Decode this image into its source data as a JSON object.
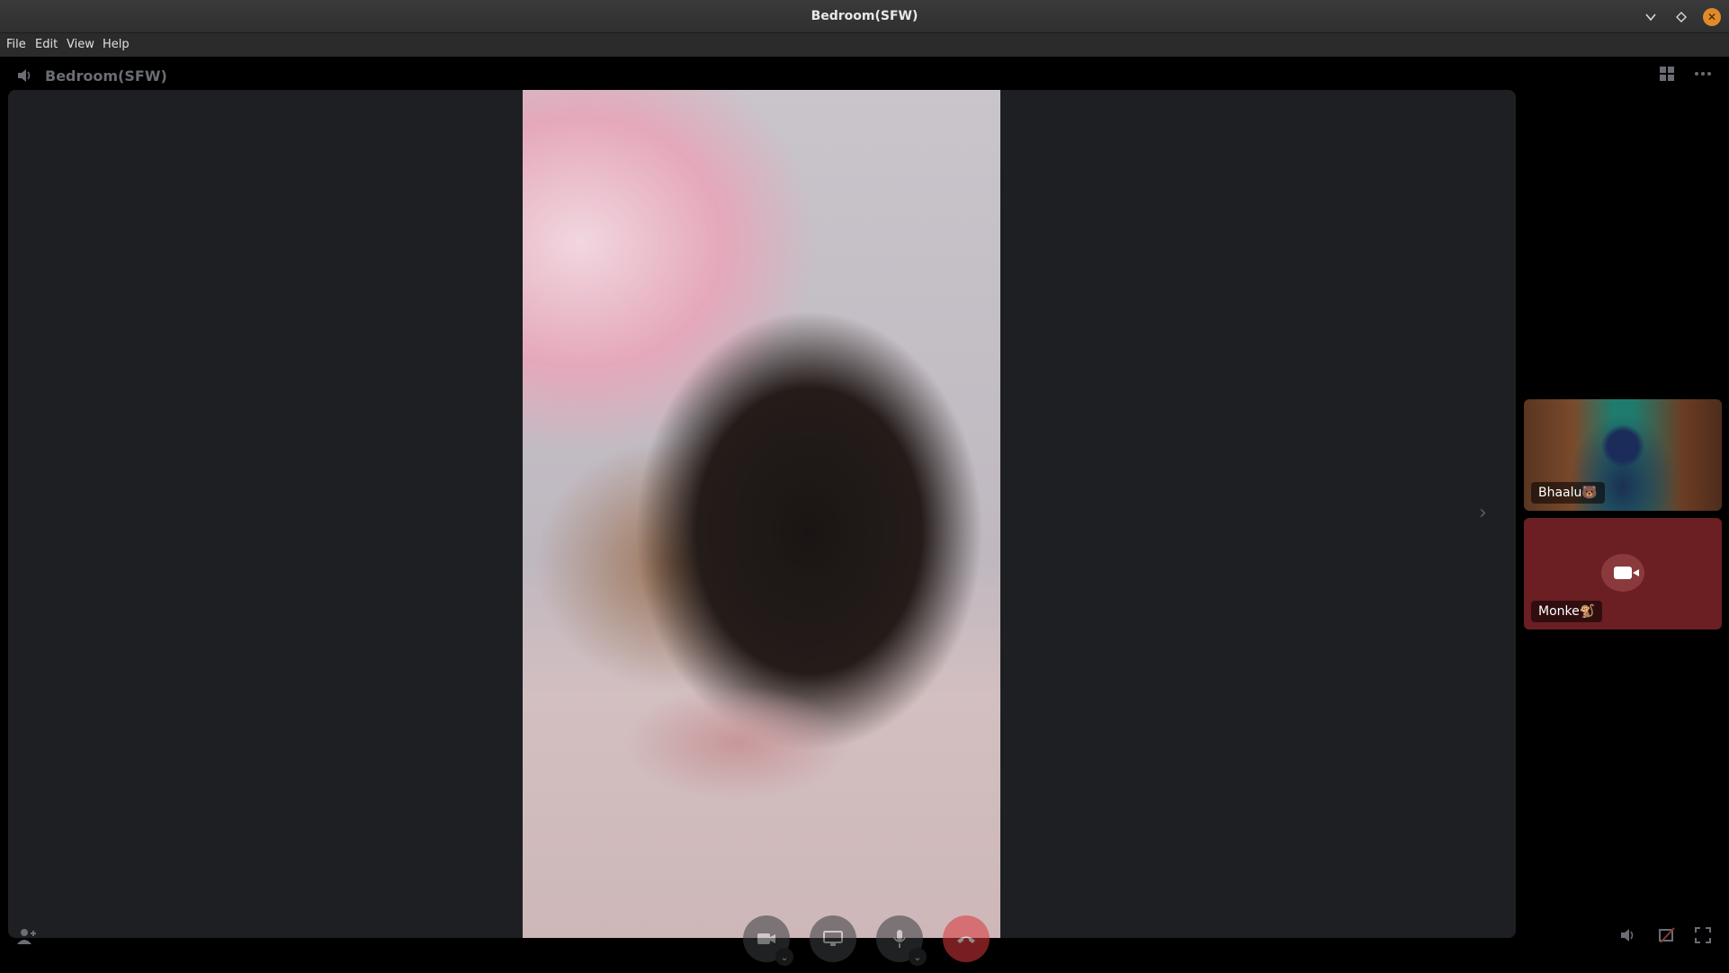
{
  "window": {
    "title": "Bedroom(SFW)",
    "minimize_icon": "chevron-down-icon",
    "maximize_icon": "diamond-icon",
    "close_icon": "close-icon"
  },
  "menu": [
    "File",
    "Edit",
    "View",
    "Help"
  ],
  "channel": {
    "name": "Bedroom(SFW)",
    "icon": "speaker-icon"
  },
  "header_icons": [
    "grid-icon",
    "more-icon"
  ],
  "participants": [
    {
      "name": "Bhaalu🐻",
      "camera": true
    },
    {
      "name": "Monke🐒",
      "camera": false
    }
  ],
  "controls": [
    "camera",
    "screen-share",
    "microphone",
    "disconnect"
  ],
  "bottom_icons": [
    "invite-icon",
    "volume-icon",
    "popout-icon",
    "fullscreen-icon"
  ],
  "colors": {
    "stage": "#1e1f22",
    "end_call": "#da373c",
    "nocam_tile": "#6b1f22",
    "close_button": "#e08a2a"
  }
}
